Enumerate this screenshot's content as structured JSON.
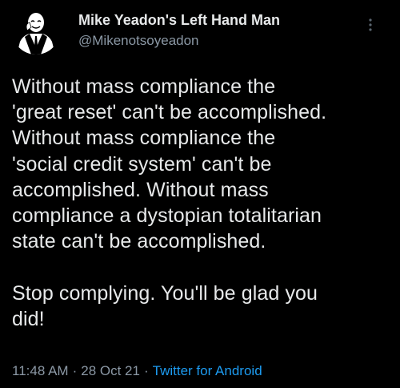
{
  "author": {
    "display_name": "Mike Yeadon's Left Hand Man",
    "handle": "@Mikenotsoyeadon",
    "avatar_icon": "anonymous-mask-suit-avatar"
  },
  "menu": {
    "icon": "more-vertical-icon"
  },
  "tweet": {
    "text": "Without mass compliance the\n'great reset' can't be accomplished.\nWithout mass compliance the\n'social credit system' can't be\naccomplished. Without mass\ncompliance a dystopian totalitarian\nstate can't be accomplished.\n\nStop complying. You'll be glad you\ndid!"
  },
  "meta": {
    "time": "11:48 AM",
    "separator": "·",
    "date": "28 Oct 21",
    "source": "Twitter for Android"
  },
  "colors": {
    "background": "#000000",
    "text": "#e7e9ea",
    "secondary": "#8b98a5",
    "link": "#1d9bf0"
  }
}
